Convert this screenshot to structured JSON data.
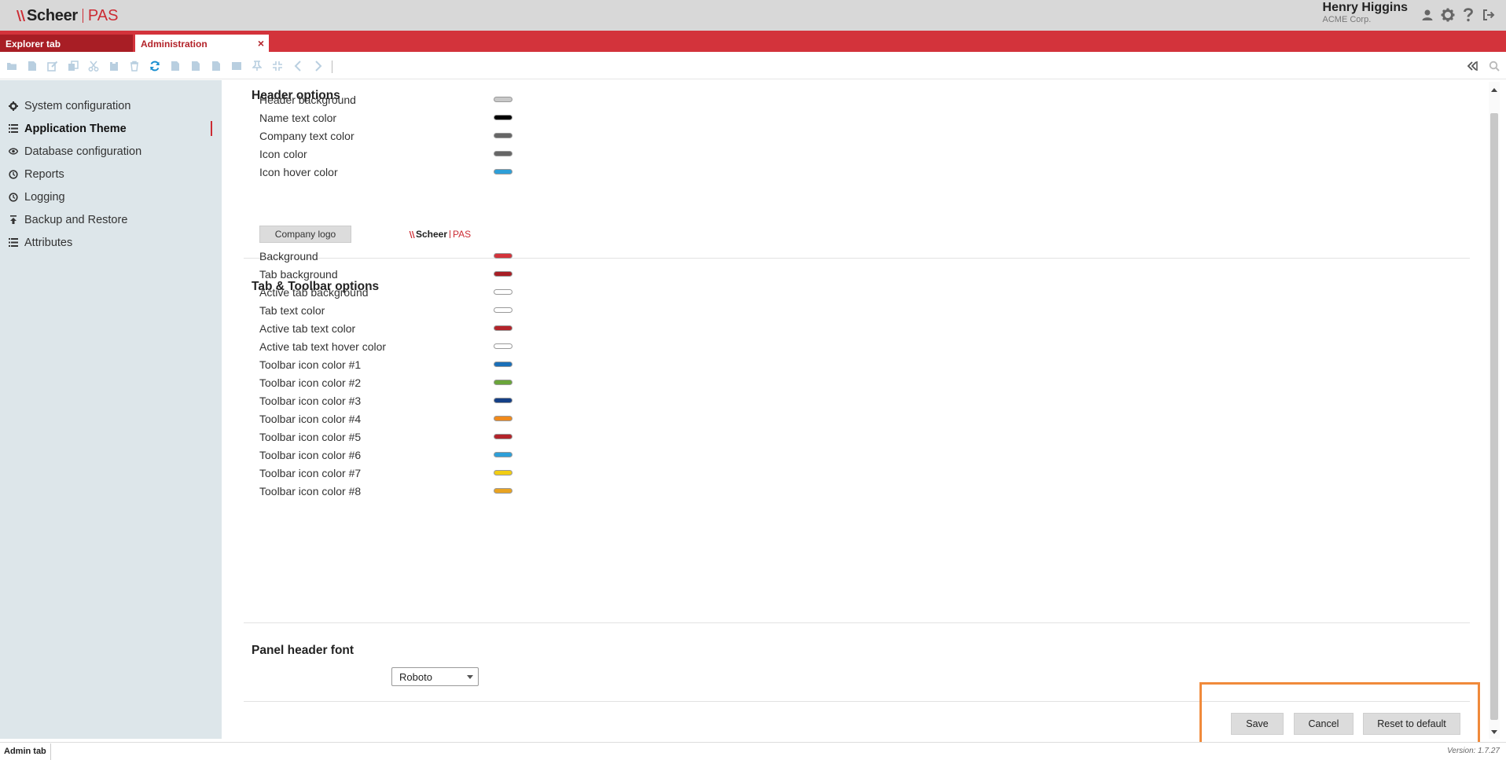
{
  "header": {
    "logo_mark": "∧",
    "logo_name": "Scheer",
    "logo_product": "PAS",
    "user_name": "Henry Higgins",
    "user_company": "ACME Corp.",
    "icons": [
      "user-icon",
      "gear-icon",
      "help-icon",
      "logout-icon"
    ]
  },
  "tabs": {
    "explorer": "Explorer tab",
    "admin": "Administration",
    "close": "×"
  },
  "sidebar": {
    "items": [
      {
        "label": "System configuration",
        "icon": "gear-icon"
      },
      {
        "label": "Application Theme",
        "icon": "list-icon",
        "active": true
      },
      {
        "label": "Database configuration",
        "icon": "eye-icon"
      },
      {
        "label": "Reports",
        "icon": "history-icon"
      },
      {
        "label": "Logging",
        "icon": "history-icon"
      },
      {
        "label": "Backup and Restore",
        "icon": "upload-icon"
      },
      {
        "label": "Attributes",
        "icon": "list-icon"
      }
    ]
  },
  "header_options": {
    "title": "Header options",
    "items": [
      {
        "label": "Header background",
        "color": "#c8c8c8"
      },
      {
        "label": "Name text color",
        "color": "#000000"
      },
      {
        "label": "Company text color",
        "color": "#666666"
      },
      {
        "label": "Icon color",
        "color": "#666666"
      },
      {
        "label": "Icon hover color",
        "color": "#2e9fd8"
      }
    ],
    "company_logo_button": "Company logo",
    "logo_preview": {
      "mark": "∧",
      "name": "Scheer",
      "product": "PAS"
    }
  },
  "tab_toolbar_options": {
    "title": "Tab & Toolbar options",
    "items": [
      {
        "label": "Background",
        "color": "#d3333b"
      },
      {
        "label": "Tab background",
        "color": "#a81e25"
      },
      {
        "label": "Active tab background",
        "color": "#ffffff"
      },
      {
        "label": "Tab text color",
        "color": "#ffffff"
      },
      {
        "label": "Active tab text color",
        "color": "#b3232a"
      },
      {
        "label": "Active tab text hover color",
        "color": "#ffffff"
      },
      {
        "label": "Toolbar icon color #1",
        "color": "#1a6fb8"
      },
      {
        "label": "Toolbar icon color #2",
        "color": "#6aa53a"
      },
      {
        "label": "Toolbar icon color #3",
        "color": "#143f86"
      },
      {
        "label": "Toolbar icon color #4",
        "color": "#f08a1c"
      },
      {
        "label": "Toolbar icon color #5",
        "color": "#b3232a"
      },
      {
        "label": "Toolbar icon color #6",
        "color": "#2e9fd8"
      },
      {
        "label": "Toolbar icon color #7",
        "color": "#f2cd13"
      },
      {
        "label": "Toolbar icon color #8",
        "color": "#e9a321"
      }
    ]
  },
  "panel_font": {
    "title": "Panel header font",
    "selected": "Roboto"
  },
  "actions": {
    "save": "Save",
    "cancel": "Cancel",
    "reset": "Reset to default"
  },
  "status_bar": {
    "tab": "Admin tab",
    "version": "Version: 1.7.27"
  }
}
